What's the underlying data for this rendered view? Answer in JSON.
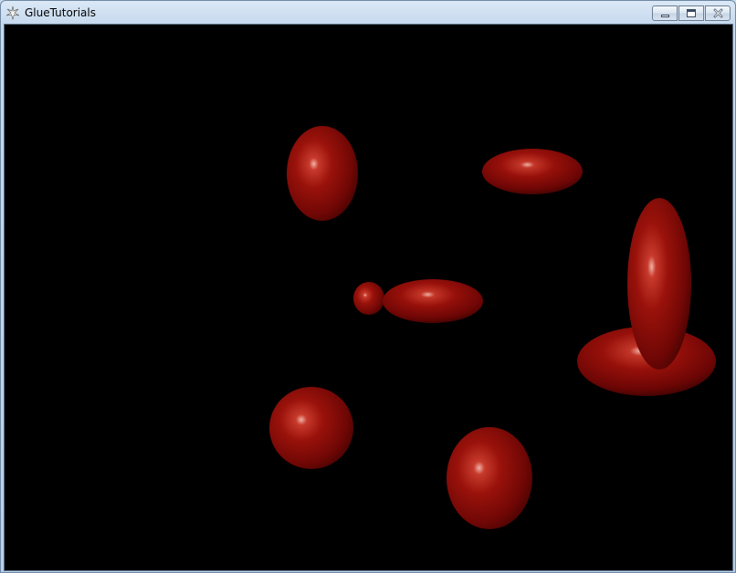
{
  "window": {
    "title": "GlueTutorials",
    "icon": "app-icon"
  },
  "titlebar": {
    "buttons": [
      {
        "name": "minimize-button",
        "icon": "minimize-icon"
      },
      {
        "name": "maximize-button",
        "icon": "maximize-icon"
      },
      {
        "name": "close-button",
        "icon": "close-icon"
      }
    ]
  },
  "scene": {
    "background": "#000000",
    "object_color": "#8b0a06",
    "highlight_color": "#e89a90"
  }
}
